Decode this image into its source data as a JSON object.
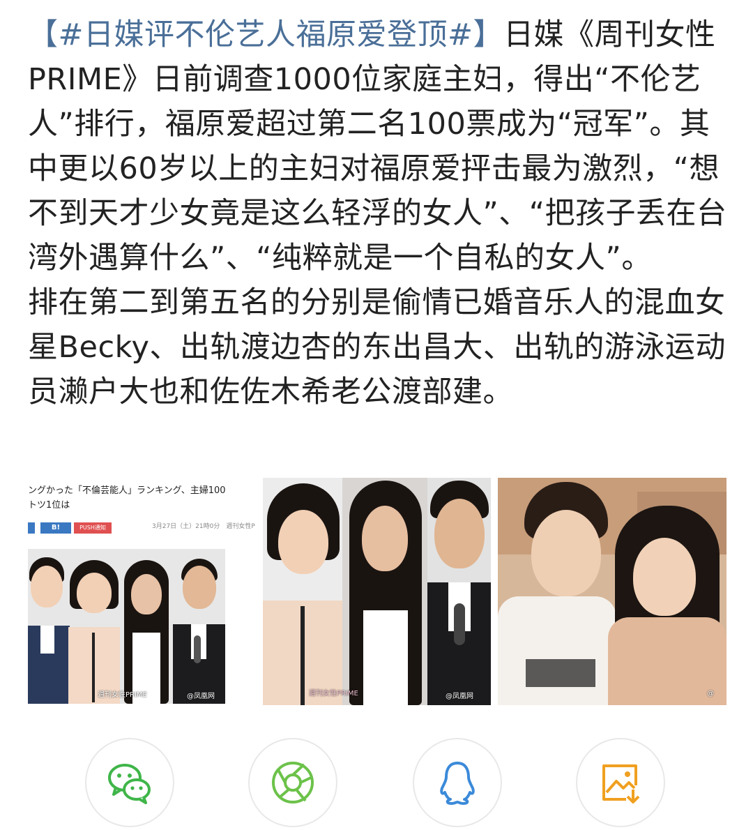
{
  "post": {
    "hashtag": "【#日媒评不伦艺人福原爱登顶#】",
    "body": "日媒《周刊女性PRIME》日前调查1000位家庭主妇，得出“不伦艺人”排行，福原爱超过第二名100票成为“冠军”。其中更以60岁以上的主妇对福原爱抨击最为激烈，“想不到天才少女竟是这么轻浮的女人”、“把孩子丢在台湾外遇算什么”、“纯粹就是一个自私的女人”。",
    "body2": "排在第二到第五名的分别是偷情已婚音乐人的混血女星Becky、出轨渡边杏的东出昌大、出轨的游泳运动员濑户大也和佐佐木希老公渡部建。"
  },
  "images": {
    "panel1_headline": "ングかった「不倫芸能人」ランキング、主婦100",
    "panel1_headline2": "トツ1位は",
    "panel1_tag_b": "B!",
    "panel1_tag_push": "PUSH通知",
    "panel1_date": "3月27日（土）21時0分　週刊女性P",
    "panel1_watermark": "@凤凰网",
    "panel1_brand": "週刊女性PRIME",
    "panel2_brand": "週刊女性PRIME",
    "panel2_watermark": "@凤凰网",
    "panel3_watermark": "@"
  },
  "share": {
    "icons": [
      "wechat-icon",
      "moments-icon",
      "qq-icon",
      "save-image-icon"
    ],
    "colors": {
      "wechat": "#3fb549",
      "moments": "#6cc24a",
      "qq": "#3b8ad9",
      "save": "#f0a020"
    }
  }
}
